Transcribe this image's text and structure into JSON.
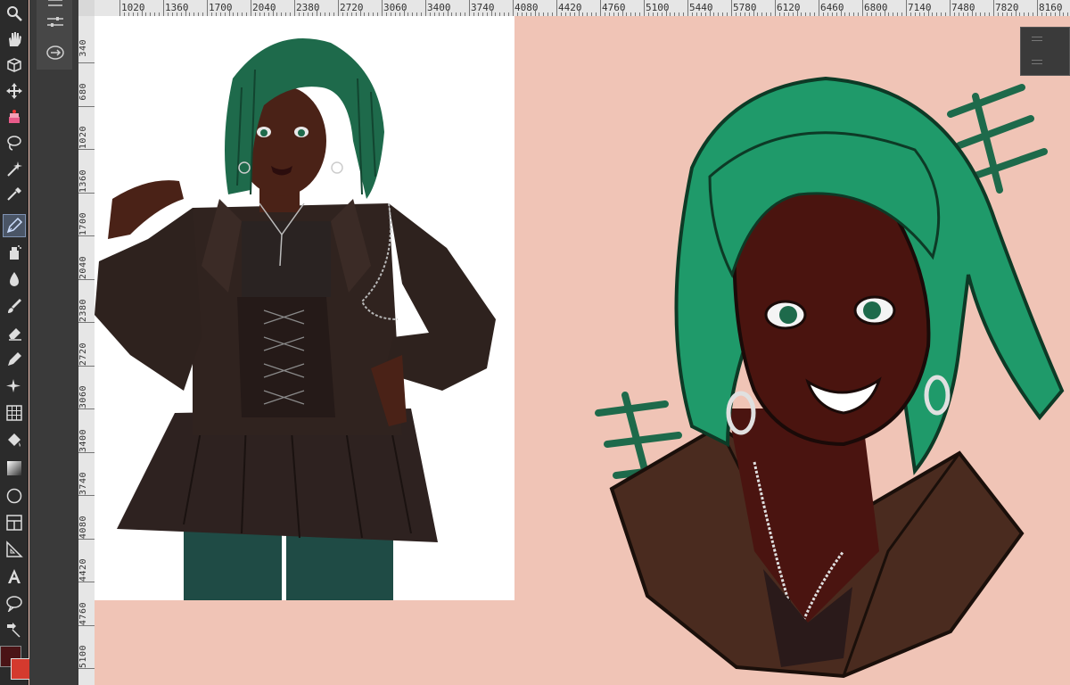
{
  "tools": [
    {
      "name": "zoom-icon",
      "active": false
    },
    {
      "name": "hand-icon",
      "active": false
    },
    {
      "name": "object-icon",
      "active": false
    },
    {
      "name": "move-icon",
      "active": false
    },
    {
      "name": "cake-icon",
      "active": false
    },
    {
      "name": "lasso-select-icon",
      "active": false
    },
    {
      "name": "magic-wand-icon",
      "active": false
    },
    {
      "name": "eyedropper-icon",
      "active": false
    },
    {
      "name": "pen-icon",
      "active": true
    },
    {
      "name": "pencil-spray-icon",
      "active": false
    },
    {
      "name": "water-drop-icon",
      "active": false
    },
    {
      "name": "brush-icon",
      "active": false
    },
    {
      "name": "eraser-icon",
      "active": false
    },
    {
      "name": "blend-pen-icon",
      "active": false
    },
    {
      "name": "sparkle-icon",
      "active": false
    },
    {
      "name": "grid-icon",
      "active": false
    },
    {
      "name": "fill-bucket-icon",
      "active": false
    },
    {
      "name": "gradient-icon",
      "active": false
    },
    {
      "name": "circle-shape-icon",
      "active": false
    },
    {
      "name": "frame-icon",
      "active": false
    },
    {
      "name": "ruler-icon",
      "active": false
    },
    {
      "name": "text-icon",
      "active": false
    },
    {
      "name": "speech-balloon-icon",
      "active": false
    },
    {
      "name": "correct-line-icon",
      "active": false
    }
  ],
  "colors": {
    "main_color": "#4a1416",
    "sub_color": "#d43a2e",
    "canvas_background": "#f0c4b6"
  },
  "ruler_h": [
    "1020",
    "1360",
    "1700",
    "2040",
    "2380",
    "2720",
    "3060",
    "3400",
    "3740",
    "4080",
    "4420",
    "4760",
    "5100",
    "5440",
    "5780",
    "6120",
    "6460",
    "6800",
    "7140",
    "7480",
    "7820",
    "8160"
  ],
  "ruler_v": [
    "340",
    "680",
    "1020",
    "1360",
    "1700",
    "2040",
    "2380",
    "2720",
    "3060",
    "3400",
    "3740",
    "4080",
    "4420",
    "4760",
    "5100"
  ]
}
